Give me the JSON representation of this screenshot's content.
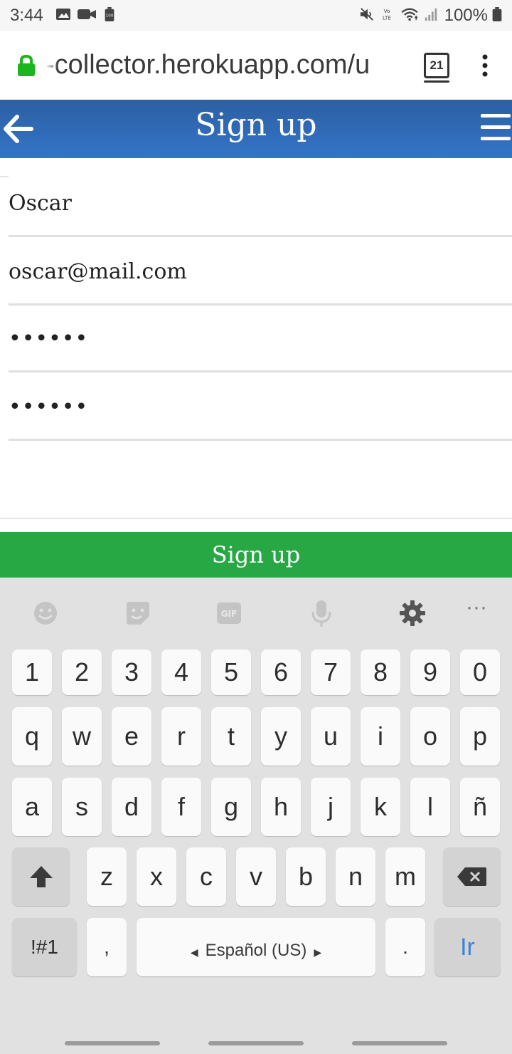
{
  "status_bar": {
    "time": "3:44",
    "battery": "100%",
    "icons": [
      "gallery-icon",
      "video-icon",
      "battery-saver-icon",
      "mute-icon",
      "volte-icon",
      "wifi-icon",
      "signal-icon",
      "battery-icon"
    ]
  },
  "browser": {
    "url": "-collector.herokuapp.com/u",
    "tab_count": "21",
    "lock_color": "#1bb520"
  },
  "app_bar": {
    "title": "Sign up",
    "color_top": "#2d5fa2",
    "color_bottom": "#3374c8"
  },
  "form": {
    "name_value": "Oscar",
    "email_value": "oscar@mail.com",
    "password_mask": "••••••",
    "confirm_mask": "••••••",
    "submit_label": "Sign up",
    "submit_color": "#28a745"
  },
  "keyboard": {
    "toolbar": [
      "emoji-icon",
      "sticker-icon",
      "gif-icon",
      "mic-icon",
      "settings-icon",
      "more-icon"
    ],
    "gif_label": "GIF",
    "more_label": "···",
    "row_numbers": [
      "1",
      "2",
      "3",
      "4",
      "5",
      "6",
      "7",
      "8",
      "9",
      "0"
    ],
    "row_q": [
      "q",
      "w",
      "e",
      "r",
      "t",
      "y",
      "u",
      "i",
      "o",
      "p"
    ],
    "row_a": [
      "a",
      "s",
      "d",
      "f",
      "g",
      "h",
      "j",
      "k",
      "l",
      "ñ"
    ],
    "row_z": [
      "z",
      "x",
      "c",
      "v",
      "b",
      "n",
      "m"
    ],
    "symbols_label": "!#1",
    "comma_label": ",",
    "space_label": "Español (US)",
    "period_label": ".",
    "go_label": "Ir"
  }
}
